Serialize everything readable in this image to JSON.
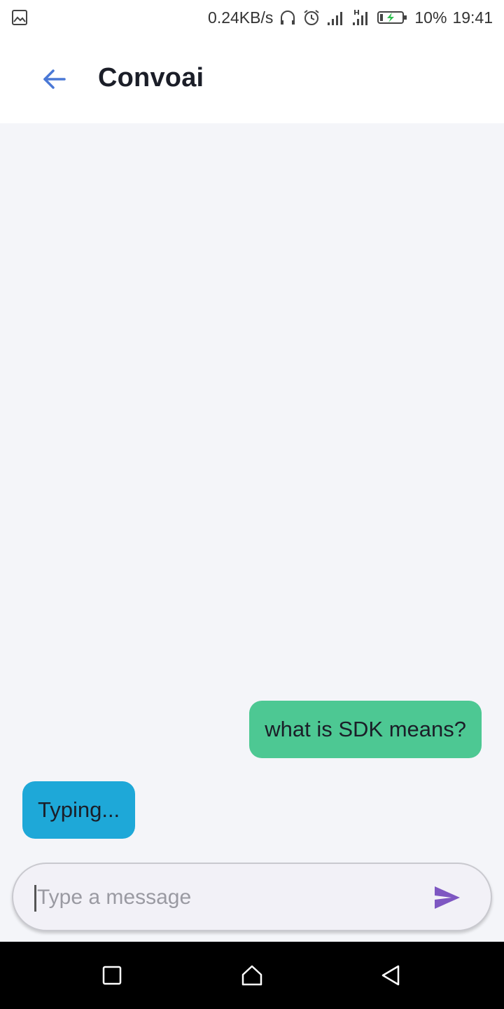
{
  "status_bar": {
    "net_speed": "0.24KB/s",
    "battery_percent": "10%",
    "time": "19:41",
    "icons": [
      "gallery-icon",
      "headphones-icon",
      "alarm-icon",
      "signal-icon",
      "signal-hplus-icon",
      "battery-charging-icon"
    ]
  },
  "app_bar": {
    "title": "Convoai",
    "back_icon": "arrow-left-icon",
    "accent_color": "#4a78d6"
  },
  "messages": [
    {
      "sender": "user",
      "text": "what is SDK means?",
      "color": "#4dc893"
    },
    {
      "sender": "bot",
      "text": "Typing...",
      "color": "#1ea8d8"
    }
  ],
  "composer": {
    "placeholder": "Type a message",
    "value": "",
    "send_icon": "send-icon",
    "send_color": "#7e57c2"
  },
  "nav_bar": {
    "buttons": [
      "recents-icon",
      "home-icon",
      "back-triangle-icon"
    ]
  }
}
